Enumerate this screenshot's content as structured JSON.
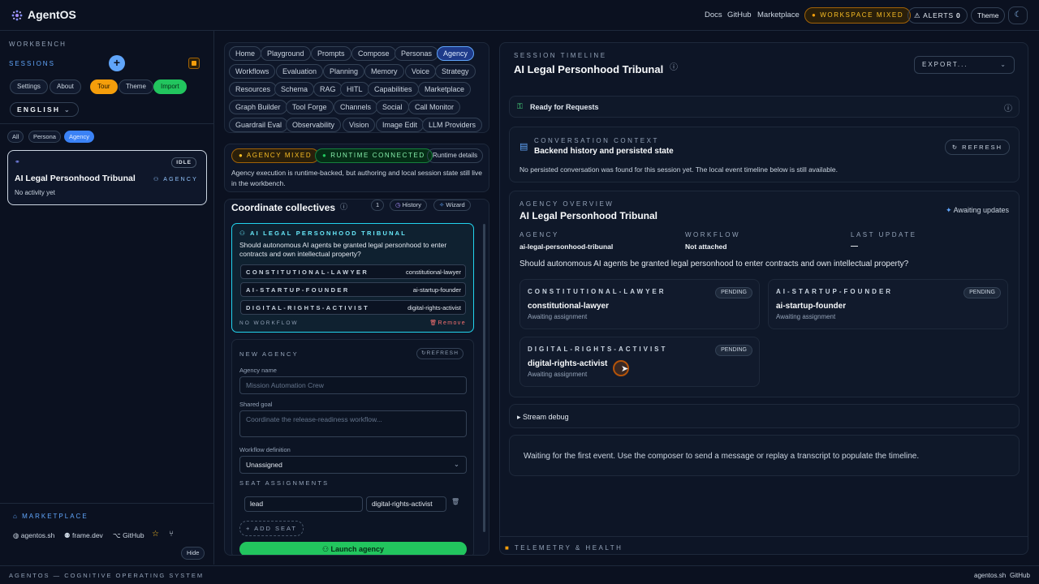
{
  "brand": {
    "name": "AgentOS"
  },
  "topbar": {
    "links": [
      "Docs",
      "GitHub",
      "Marketplace"
    ],
    "workspace_badge": "WORKSPACE MIXED",
    "alerts_label": "ALERTS",
    "alerts_count": "0",
    "theme_label": "Theme"
  },
  "sidebar": {
    "workbench_label": "WORKBENCH",
    "sessions_label": "SESSIONS",
    "buttons": [
      "Settings",
      "About",
      "Tour",
      "Theme",
      "Import"
    ],
    "language": "ENGLISH",
    "filters": [
      "All",
      "Persona",
      "Agency"
    ],
    "session": {
      "title": "AI Legal Personhood Tribunal",
      "status": "IDLE",
      "kind": "AGENCY",
      "activity": "No activity yet"
    },
    "marketplace_label": "MARKETPLACE",
    "footer_links": [
      "agentos.sh",
      "frame.dev",
      "GitHub"
    ],
    "hide_label": "Hide"
  },
  "nav": {
    "tabs": [
      "Home",
      "Playground",
      "Prompts",
      "Compose",
      "Personas",
      "Agency",
      "Workflows",
      "Evaluation",
      "Planning",
      "Memory",
      "Voice",
      "Strategy",
      "Resources",
      "Schema",
      "RAG",
      "HITL",
      "Capabilities",
      "Marketplace",
      "Graph Builder",
      "Tool Forge",
      "Channels",
      "Social",
      "Call Monitor",
      "Guardrail Eval",
      "Observability",
      "Vision",
      "Image Edit",
      "LLM Providers"
    ],
    "active": "Agency"
  },
  "status": {
    "agency_badge": "AGENCY MIXED",
    "runtime_badge": "RUNTIME CONNECTED",
    "runtime_details": "Runtime details",
    "description": "Agency execution is runtime-backed, but authoring and local session state still live in the workbench."
  },
  "panel": {
    "title": "Coordinate collectives",
    "count": "1",
    "history_label": "History",
    "wizard_label": "Wizard",
    "agency": {
      "name": "AI LEGAL PERSONHOOD TRIBUNAL",
      "goal": "Should autonomous AI agents be granted legal personhood to enter contracts and own intellectual property?",
      "seats": [
        {
          "role": "CONSTITUTIONAL-LAWYER",
          "persona": "constitutional-lawyer"
        },
        {
          "role": "AI-STARTUP-FOUNDER",
          "persona": "ai-startup-founder"
        },
        {
          "role": "DIGITAL-RIGHTS-ACTIVIST",
          "persona": "digital-rights-activist"
        }
      ],
      "workflow_note": "NO WORKFLOW",
      "remove_label": "Remove"
    },
    "new_agency": {
      "label": "NEW AGENCY",
      "refresh": "REFRESH",
      "name_label": "Agency name",
      "name_placeholder": "Mission Automation Crew",
      "goal_label": "Shared goal",
      "goal_placeholder": "Coordinate the release-readiness workflow...",
      "workflow_label": "Workflow definition",
      "workflow_value": "Unassigned",
      "seat_assignments_label": "SEAT ASSIGNMENTS",
      "seat_role": "lead",
      "seat_persona": "digital-rights-activist",
      "add_seat": "ADD SEAT",
      "launch": "Launch agency"
    }
  },
  "timeline": {
    "label": "SESSION TIMELINE",
    "title": "AI Legal Personhood Tribunal",
    "export": "EXPORT...",
    "ready": "Ready for Requests",
    "context": {
      "label": "CONVERSATION CONTEXT",
      "title": "Backend history and persisted state",
      "refresh": "REFRESH",
      "note": "No persisted conversation was found for this session yet. The local event timeline below is still available."
    },
    "overview": {
      "label": "AGENCY OVERVIEW",
      "title": "AI Legal Personhood Tribunal",
      "awaiting": "Awaiting updates",
      "agency_label": "AGENCY",
      "agency_value": "ai-legal-personhood-tribunal",
      "workflow_label": "WORKFLOW",
      "workflow_value": "Not attached",
      "update_label": "LAST UPDATE",
      "update_value": "—",
      "goal": "Should autonomous AI agents be granted legal personhood to enter contracts and own intellectual property?",
      "seats": [
        {
          "role": "CONSTITUTIONAL-LAWYER",
          "persona": "constitutional-lawyer",
          "status": "PENDING",
          "note": "Awaiting assignment"
        },
        {
          "role": "AI-STARTUP-FOUNDER",
          "persona": "ai-startup-founder",
          "status": "PENDING",
          "note": "Awaiting assignment"
        },
        {
          "role": "DIGITAL-RIGHTS-ACTIVIST",
          "persona": "digital-rights-activist",
          "status": "PENDING",
          "note": "Awaiting assignment"
        }
      ]
    },
    "stream_debug": "Stream debug",
    "waiting": "Waiting for the first event. Use the composer to send a message or replay a transcript to populate the timeline.",
    "telemetry": "TELEMETRY & HEALTH"
  },
  "bottombar": {
    "tagline": "AGENTOS — COGNITIVE OPERATING SYSTEM",
    "links": [
      "agentos.sh",
      "GitHub"
    ]
  },
  "colors": {
    "accent": "#3b82f6",
    "warning": "#f59e0b",
    "success": "#22c55e",
    "bg": "#0b1120"
  }
}
